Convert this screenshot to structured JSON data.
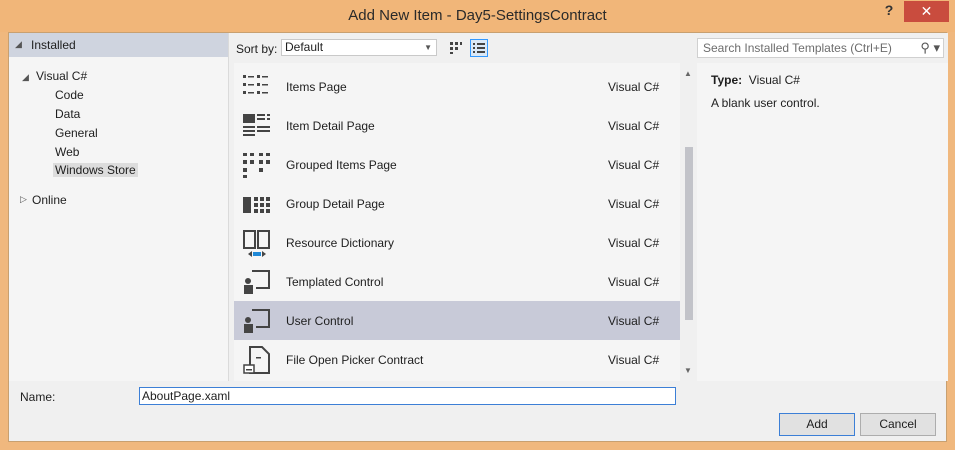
{
  "window": {
    "title": "Add New Item - Day5-SettingsContract",
    "help": "?",
    "close": "✕"
  },
  "tree": {
    "installed": "Installed",
    "visual_csharp": "Visual C#",
    "children": [
      "Code",
      "Data",
      "General",
      "Web",
      "Windows Store"
    ],
    "selected": "Windows Store",
    "online": "Online"
  },
  "toolbar": {
    "sort_label": "Sort by:",
    "sort_value": "Default",
    "search_placeholder": "Search Installed Templates (Ctrl+E)"
  },
  "templates": [
    {
      "name": "Items Page",
      "lang": "Visual C#"
    },
    {
      "name": "Item Detail Page",
      "lang": "Visual C#"
    },
    {
      "name": "Grouped Items Page",
      "lang": "Visual C#"
    },
    {
      "name": "Group Detail Page",
      "lang": "Visual C#"
    },
    {
      "name": "Resource Dictionary",
      "lang": "Visual C#"
    },
    {
      "name": "Templated Control",
      "lang": "Visual C#"
    },
    {
      "name": "User Control",
      "lang": "Visual C#"
    },
    {
      "name": "File Open Picker Contract",
      "lang": "Visual C#"
    }
  ],
  "selected_template": "User Control",
  "detail": {
    "type_label": "Type:",
    "type_value": "Visual C#",
    "description": "A blank user control."
  },
  "name_field": {
    "label": "Name:",
    "value": "AboutPage.xaml"
  },
  "buttons": {
    "add": "Add",
    "cancel": "Cancel"
  }
}
